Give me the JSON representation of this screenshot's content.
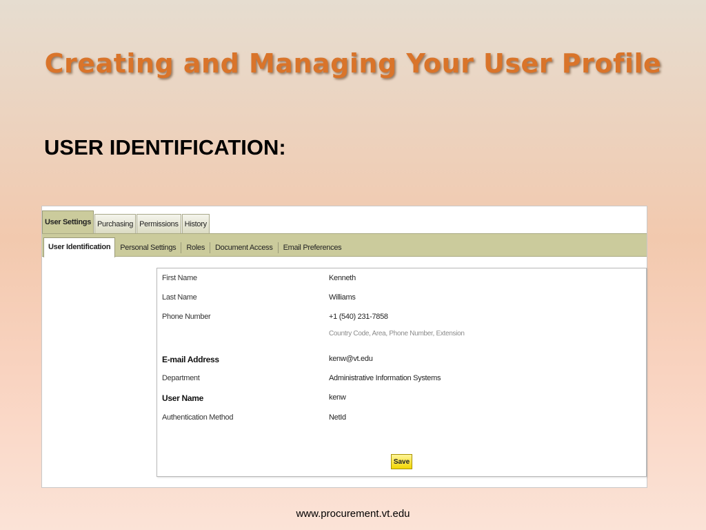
{
  "slide": {
    "title": "Creating and Managing Your User Profile",
    "section_heading": "USER IDENTIFICATION:",
    "footer_url": "www.procurement.vt.edu"
  },
  "app": {
    "top_tabs": [
      {
        "label": "User Settings",
        "active": true
      },
      {
        "label": "Purchasing",
        "active": false
      },
      {
        "label": "Permissions",
        "active": false
      },
      {
        "label": "History",
        "active": false
      }
    ],
    "sub_tabs": [
      {
        "label": "User Identification",
        "active": true
      },
      {
        "label": "Personal Settings",
        "active": false
      },
      {
        "label": "Roles",
        "active": false
      },
      {
        "label": "Document Access",
        "active": false
      },
      {
        "label": "Email Preferences",
        "active": false
      }
    ],
    "form": {
      "first_name_label": "First Name",
      "first_name_value": "Kenneth",
      "last_name_label": "Last Name",
      "last_name_value": "Williams",
      "phone_label": "Phone Number",
      "phone_value": "+1 (540) 231-7858",
      "phone_hint": "Country Code, Area, Phone Number, Extension",
      "email_label": "E-mail Address",
      "email_value": "kenw@vt.edu",
      "department_label": "Department",
      "department_value": "Administrative Information Systems",
      "username_label": "User Name",
      "username_value": "kenw",
      "auth_label": "Authentication Method",
      "auth_value": "NetId",
      "save_label": "Save"
    }
  },
  "colors": {
    "title": "#d9742a",
    "tab_bar": "#cbcb9c",
    "save_button": "#f2d600"
  }
}
